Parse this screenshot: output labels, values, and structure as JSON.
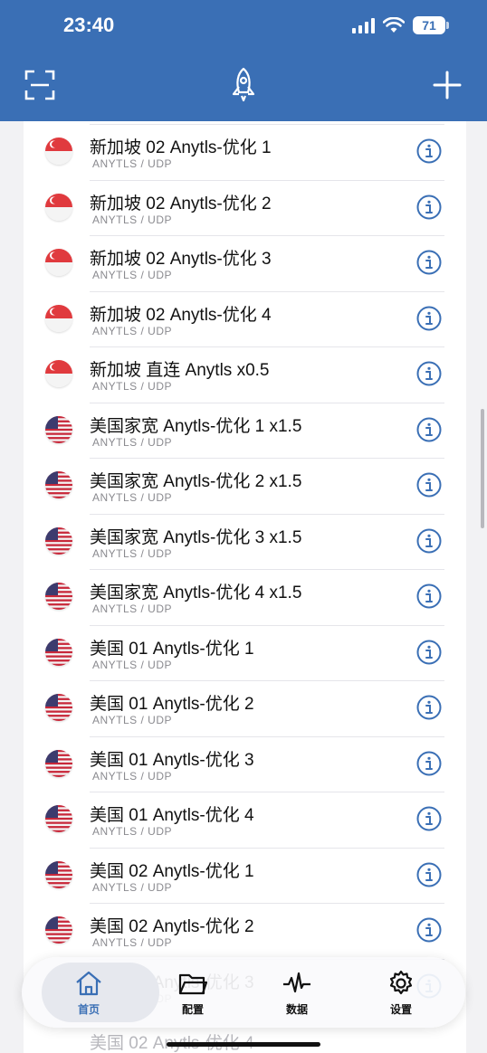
{
  "status_bar": {
    "time": "23:40",
    "battery": "71"
  },
  "header": {
    "scan_icon": "scan-icon",
    "rocket_icon": "rocket-icon",
    "add_icon": "plus-icon"
  },
  "servers": [
    {
      "name": "新加坡 02 Anytls-优化 1",
      "protocol": "ANYTLS / UDP",
      "flag": "sg"
    },
    {
      "name": "新加坡 02 Anytls-优化 2",
      "protocol": "ANYTLS / UDP",
      "flag": "sg"
    },
    {
      "name": "新加坡 02 Anytls-优化 3",
      "protocol": "ANYTLS / UDP",
      "flag": "sg"
    },
    {
      "name": "新加坡 02 Anytls-优化 4",
      "protocol": "ANYTLS / UDP",
      "flag": "sg"
    },
    {
      "name": "新加坡 直连 Anytls x0.5",
      "protocol": "ANYTLS / UDP",
      "flag": "sg"
    },
    {
      "name": "美国家宽 Anytls-优化 1 x1.5",
      "protocol": "ANYTLS / UDP",
      "flag": "us"
    },
    {
      "name": "美国家宽 Anytls-优化 2 x1.5",
      "protocol": "ANYTLS / UDP",
      "flag": "us"
    },
    {
      "name": "美国家宽 Anytls-优化 3 x1.5",
      "protocol": "ANYTLS / UDP",
      "flag": "us"
    },
    {
      "name": "美国家宽 Anytls-优化 4 x1.5",
      "protocol": "ANYTLS / UDP",
      "flag": "us"
    },
    {
      "name": "美国 01 Anytls-优化 1",
      "protocol": "ANYTLS / UDP",
      "flag": "us"
    },
    {
      "name": "美国 01 Anytls-优化 2",
      "protocol": "ANYTLS / UDP",
      "flag": "us"
    },
    {
      "name": "美国 01 Anytls-优化 3",
      "protocol": "ANYTLS / UDP",
      "flag": "us"
    },
    {
      "name": "美国 01 Anytls-优化 4",
      "protocol": "ANYTLS / UDP",
      "flag": "us"
    },
    {
      "name": "美国 02 Anytls-优化 1",
      "protocol": "ANYTLS / UDP",
      "flag": "us"
    },
    {
      "name": "美国 02 Anytls-优化 2",
      "protocol": "ANYTLS / UDP",
      "flag": "us"
    },
    {
      "name": "美国 02 Anytls-优化 3",
      "protocol": "ANYTLS / UDP",
      "flag": "us"
    }
  ],
  "faded_item": "美国 02 Anytls-优化 4",
  "tabs": [
    {
      "label": "首页",
      "icon": "home-icon",
      "active": true
    },
    {
      "label": "配置",
      "icon": "folder-icon",
      "active": false
    },
    {
      "label": "数据",
      "icon": "activity-icon",
      "active": false
    },
    {
      "label": "设置",
      "icon": "gear-icon",
      "active": false
    }
  ],
  "colors": {
    "accent": "#3a6fb5",
    "sg_red": "#e03a3e",
    "us_red": "#c8283a",
    "us_blue": "#3c3b6e"
  }
}
